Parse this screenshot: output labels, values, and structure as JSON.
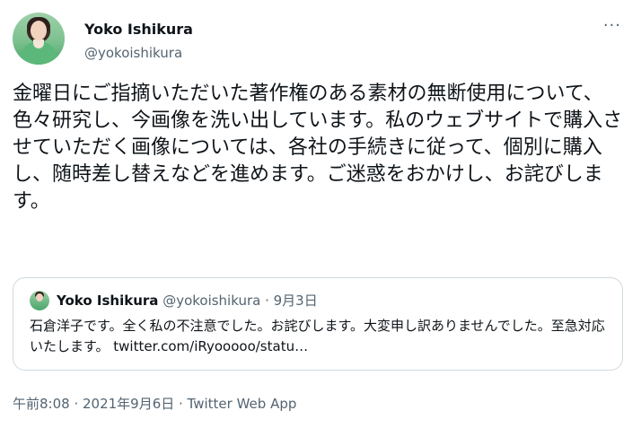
{
  "user": {
    "name": "Yoko Ishikura",
    "handle": "@yokoishikura"
  },
  "more_label": "···",
  "tweet": {
    "text": "金曜日にご指摘いただいた著作権のある素材の無断使用について、色々研究し、今画像を洗い出しています。私のウェブサイトで購入させていただく画像については、各社の手続きに従って、個別に購入し、随時差し替えなどを進めます。ご迷惑をおかけし、お詫びします。"
  },
  "quote": {
    "name": "Yoko Ishikura",
    "meta": "@yokoishikura · 9月3日",
    "text": "石倉洋子です。全く私の不注意でした。お詫びします。大変申し訳ありませんでした。至急対応いたします。 twitter.com/iRyooooo/statu…"
  },
  "footer": {
    "meta": "午前8:08 · 2021年9月6日 · Twitter Web App"
  },
  "icons": {
    "avatar": "profile-photo",
    "more": "more-options-icon"
  }
}
